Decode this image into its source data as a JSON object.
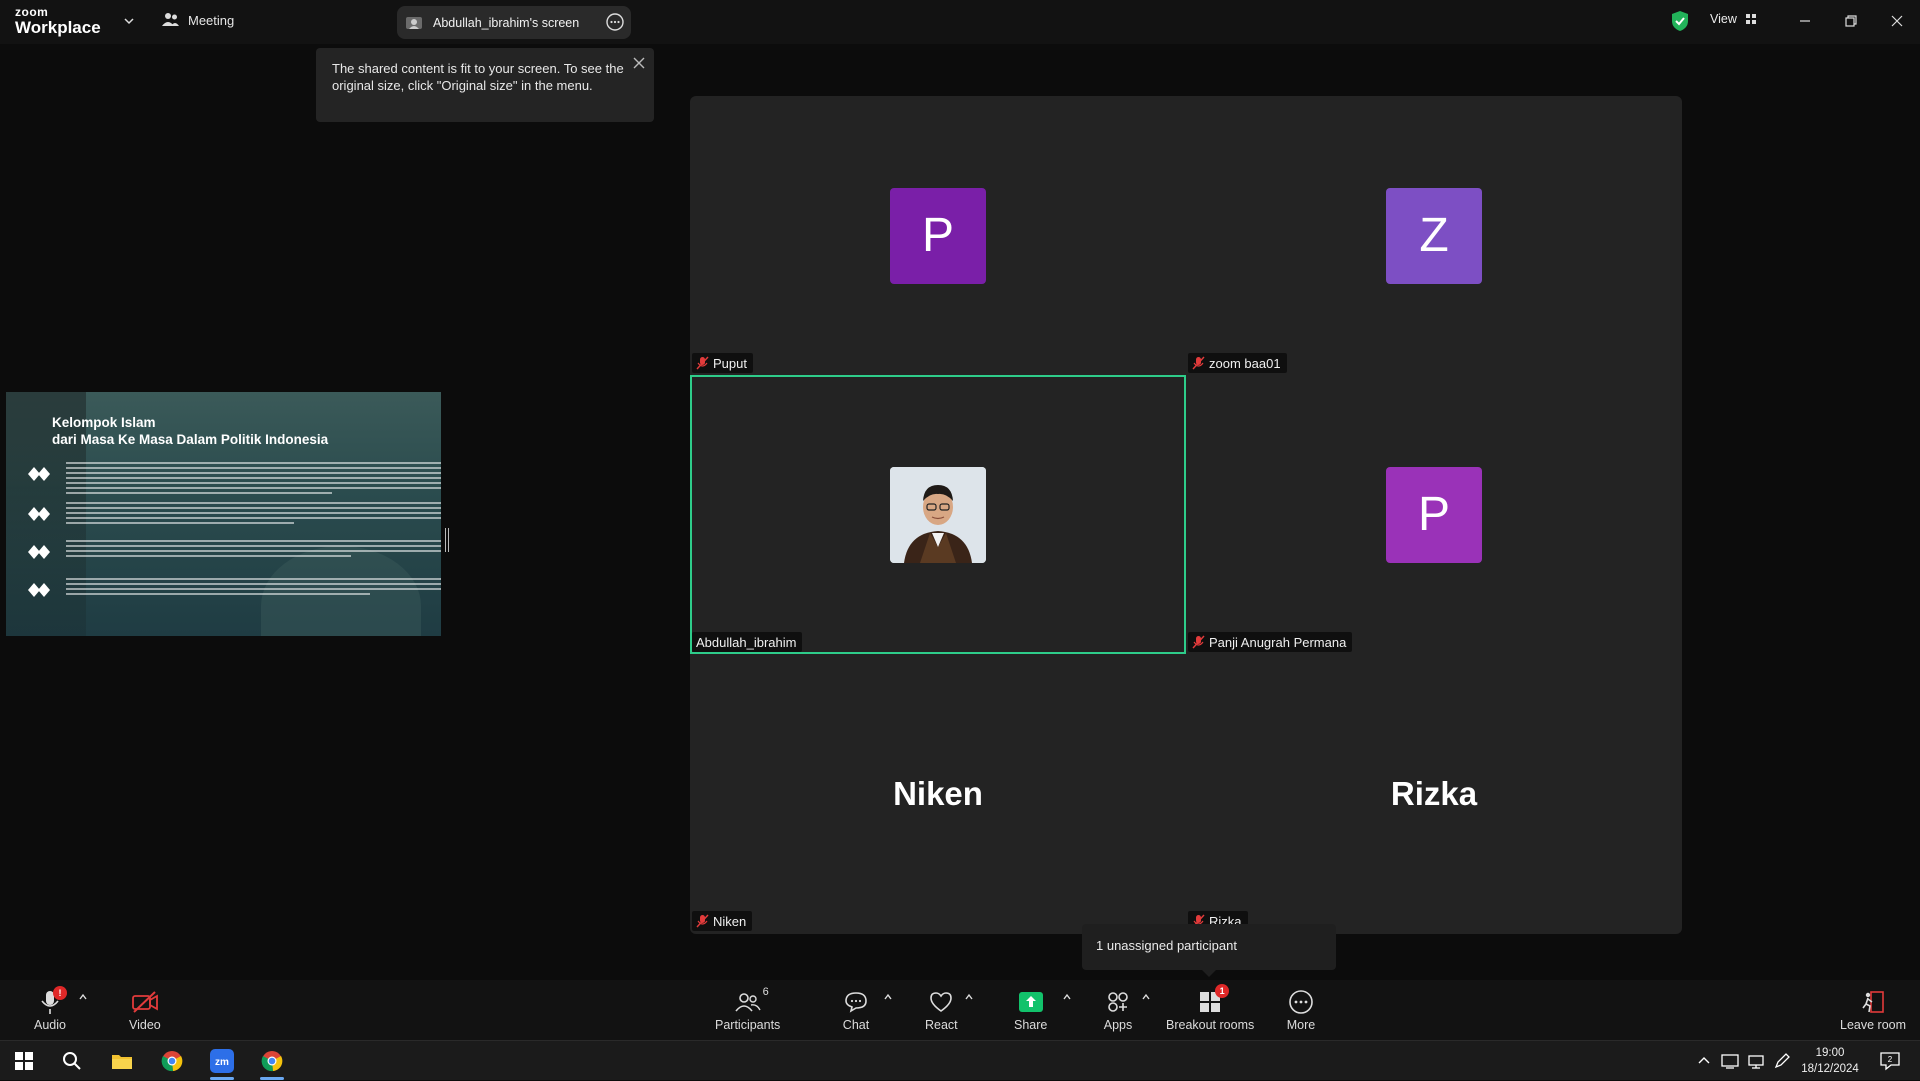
{
  "app": {
    "logo_small": "zoom",
    "logo_big": "Workplace",
    "meeting_label": "Meeting",
    "screen_pill": "Abdullah_ibrahim's screen",
    "view_label": "View"
  },
  "tooltip": {
    "text": "The shared content is fit to your screen. To see the original size, click \"Original size\" in the menu."
  },
  "slide": {
    "title_line1": "Kelompok Islam",
    "title_line2": "dari Masa Ke Masa Dalam Politik Indonesia"
  },
  "tiles": [
    {
      "name": "Puput",
      "initial": "P",
      "color": "#7a1fa8",
      "muted": true
    },
    {
      "name": "zoom baa01",
      "initial": "Z",
      "color": "#7d4fc4",
      "muted": true
    },
    {
      "name": "Abdullah_ibrahim",
      "initial": "",
      "color": "",
      "muted": false,
      "active": true
    },
    {
      "name": "Panji Anugrah Permana",
      "initial": "P",
      "color": "#9a32b8",
      "muted": true
    },
    {
      "name": "Niken",
      "display": "Niken",
      "muted": true
    },
    {
      "name": "Rizka",
      "display": "Rizka",
      "muted": true
    }
  ],
  "popup": {
    "text": "1 unassigned participant"
  },
  "toolbar": {
    "audio": "Audio",
    "video": "Video",
    "participants": "Participants",
    "participants_count": "6",
    "chat": "Chat",
    "react": "React",
    "share": "Share",
    "apps": "Apps",
    "breakout": "Breakout rooms",
    "breakout_badge": "1",
    "more": "More",
    "leave": "Leave room",
    "audio_badge": "!"
  },
  "taskbar": {
    "time": "19:00",
    "date": "18/12/2024",
    "notif_count": "2"
  },
  "colors": {
    "accent_green": "#2ecc8a",
    "share_green": "#12c26b",
    "alert_red": "#e02828"
  }
}
